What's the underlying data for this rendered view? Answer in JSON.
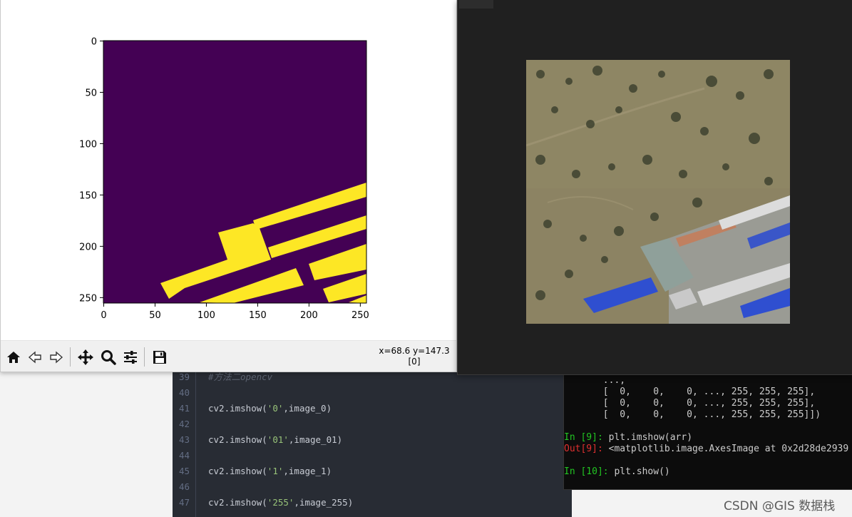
{
  "editor": {
    "lines": [
      {
        "num": "39",
        "parts": [
          {
            "t": "#方法二opencv",
            "c": "comment"
          }
        ]
      },
      {
        "num": "40",
        "parts": []
      },
      {
        "num": "41",
        "parts": [
          {
            "t": "cv2.imshow("
          },
          {
            "t": "'0'",
            "c": "str"
          },
          {
            "t": ",image_0)"
          }
        ]
      },
      {
        "num": "42",
        "parts": []
      },
      {
        "num": "43",
        "parts": [
          {
            "t": "cv2.imshow("
          },
          {
            "t": "'01'",
            "c": "str"
          },
          {
            "t": ",image_01)"
          }
        ]
      },
      {
        "num": "44",
        "parts": []
      },
      {
        "num": "45",
        "parts": [
          {
            "t": "cv2.imshow("
          },
          {
            "t": "'1'",
            "c": "str"
          },
          {
            "t": ",image_1)"
          }
        ]
      },
      {
        "num": "46",
        "parts": []
      },
      {
        "num": "47",
        "parts": [
          {
            "t": "cv2.imshow("
          },
          {
            "t": "'255'",
            "c": "str"
          },
          {
            "t": ",image_255)"
          }
        ]
      }
    ]
  },
  "console": {
    "array_tail": [
      "       ...,",
      "       [  0,    0,    0, ..., 255, 255, 255],",
      "       [  0,    0,    0, ..., 255, 255, 255],",
      "       [  0,    0,    0, ..., 255, 255, 255]])"
    ],
    "in9_prompt": "In [9]:",
    "in9_code": " plt.imshow(arr)",
    "out9_prompt": "Out[9]:",
    "out9_text": " <matplotlib.image.AxesImage at 0x2d28de2939",
    "in10_prompt": "In [10]:",
    "in10_code": " plt.show()"
  },
  "watermark": "CSDN @GIS 数据栈",
  "figure": {
    "x_ticks": [
      "0",
      "50",
      "100",
      "150",
      "200",
      "250"
    ],
    "y_ticks": [
      "0",
      "50",
      "100",
      "150",
      "200",
      "250"
    ],
    "colors": {
      "background": "#440154",
      "foreground": "#fde725"
    },
    "image_size": 256
  },
  "toolbar": {
    "buttons": [
      "home-icon",
      "back-arrow-icon",
      "forward-arrow-icon",
      "pan-move-icon",
      "zoom-magnifier-icon",
      "configure-subplots-icon",
      "save-floppy-icon"
    ],
    "coord_line1": "x=68.6 y=147.3",
    "coord_line2": "[0]"
  }
}
